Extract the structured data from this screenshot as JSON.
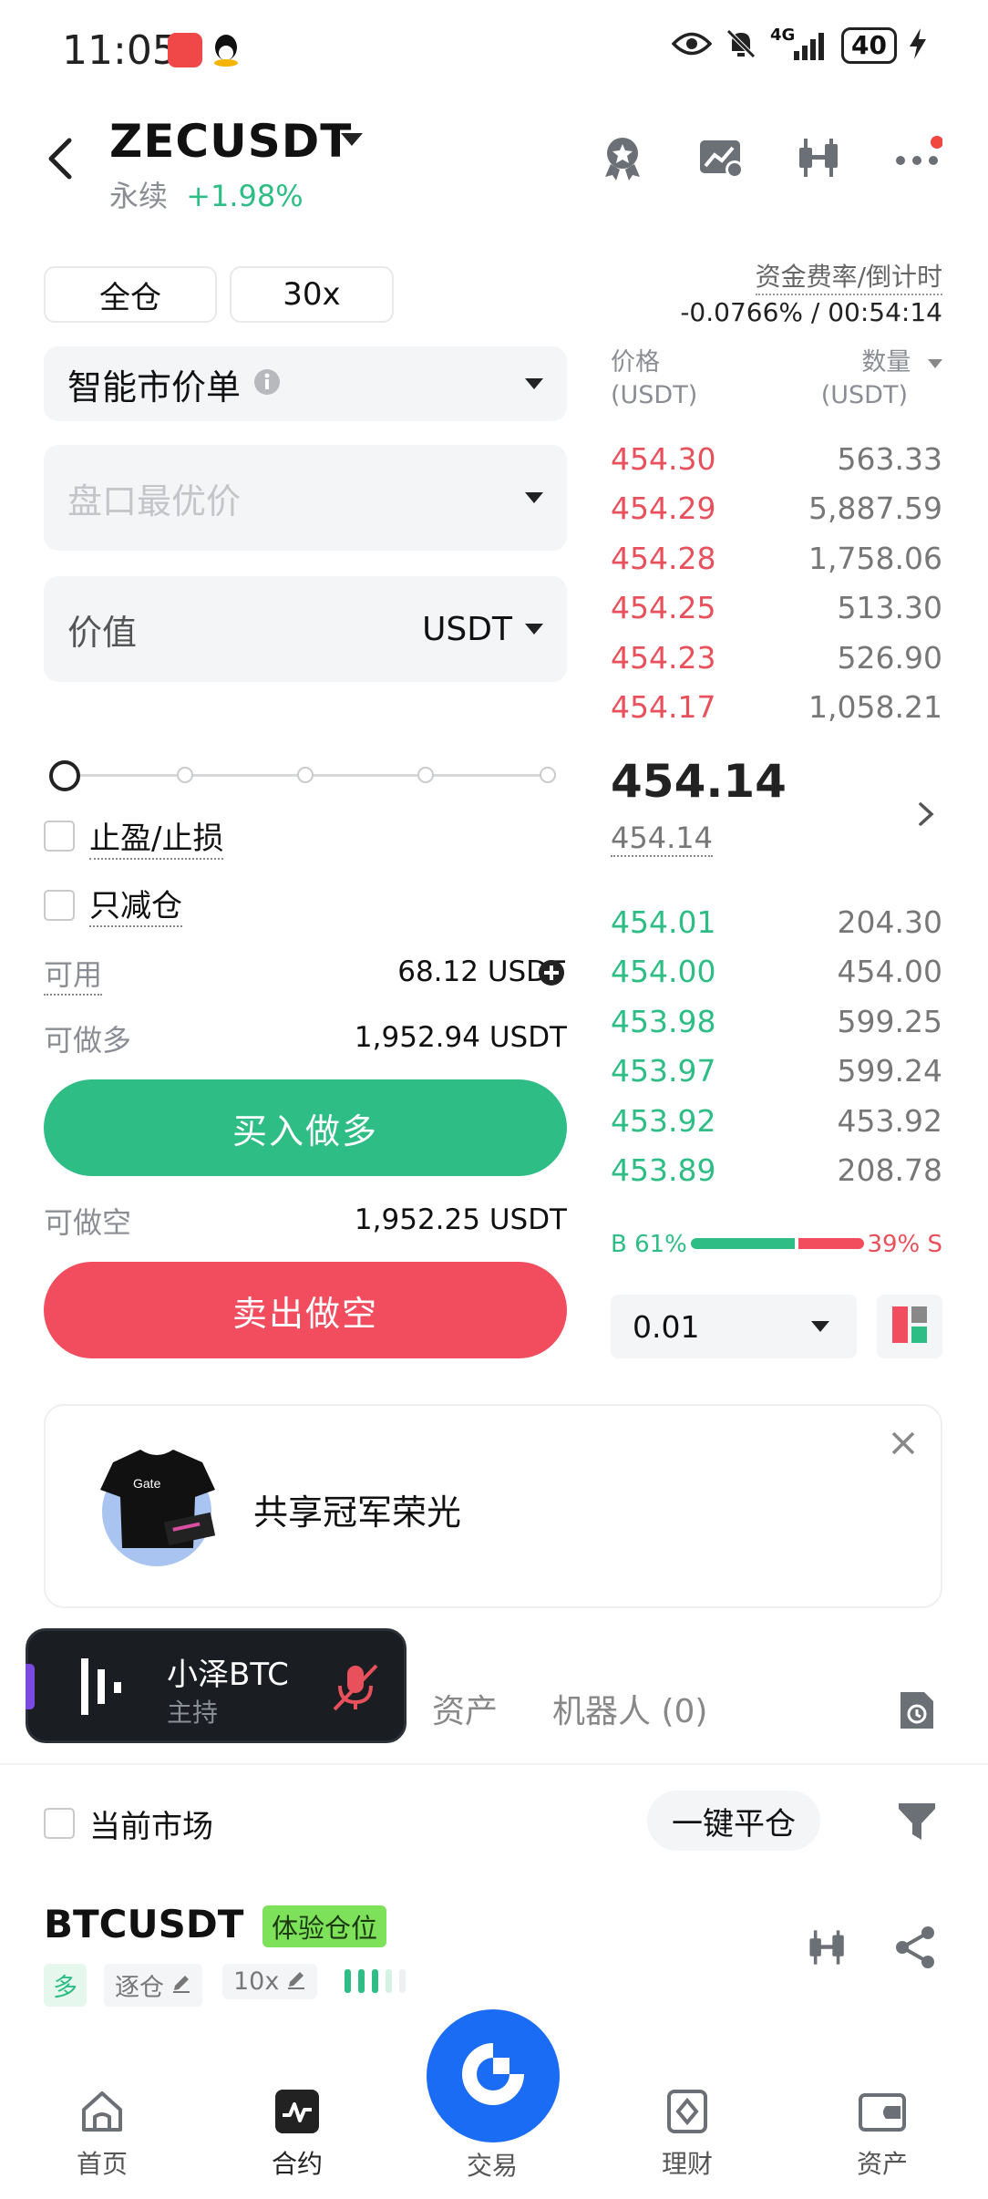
{
  "status": {
    "time": "11:05",
    "network": "4G",
    "battery": "40"
  },
  "header": {
    "pair": "ZECUSDT",
    "type": "永续",
    "change": "+1.98%"
  },
  "margin": {
    "mode": "全仓",
    "leverage": "30x"
  },
  "funding": {
    "label": "资金费率/倒计时",
    "value": "-0.0766% / 00:54:14"
  },
  "form": {
    "order_type": "智能市价单",
    "price_placeholder": "盘口最优价",
    "value_label": "价值",
    "value_unit": "USDT",
    "tp_sl": "止盈/止损",
    "reduce_only": "只减仓",
    "available_label": "可用",
    "available_value": "68.12  USDT",
    "long_label": "可做多",
    "long_value": "1,952.94 USDT",
    "buy_button": "买入做多",
    "short_label": "可做空",
    "short_value": "1,952.25 USDT",
    "sell_button": "卖出做空"
  },
  "orderbook": {
    "price_header": "价格",
    "price_unit": "(USDT)",
    "qty_header": "数量",
    "qty_unit": "(USDT)",
    "asks": [
      {
        "price": "454.30",
        "qty": "563.33"
      },
      {
        "price": "454.29",
        "qty": "5,887.59"
      },
      {
        "price": "454.28",
        "qty": "1,758.06"
      },
      {
        "price": "454.25",
        "qty": "513.30"
      },
      {
        "price": "454.23",
        "qty": "526.90"
      },
      {
        "price": "454.17",
        "qty": "1,058.21"
      }
    ],
    "last_price": "454.14",
    "mark_price": "454.14",
    "bids": [
      {
        "price": "454.01",
        "qty": "204.30"
      },
      {
        "price": "454.00",
        "qty": "454.00"
      },
      {
        "price": "453.98",
        "qty": "599.25"
      },
      {
        "price": "453.97",
        "qty": "599.24"
      },
      {
        "price": "453.92",
        "qty": "453.92"
      },
      {
        "price": "453.89",
        "qty": "208.78"
      }
    ],
    "buy_ratio": "B 61%",
    "sell_ratio": "39% S",
    "buy_fraction": 0.61,
    "precision": "0.01"
  },
  "promo": {
    "text": "共享冠军荣光",
    "shirt_logo": "Gate"
  },
  "live": {
    "host": "小泽BTC",
    "role": "主持"
  },
  "tabs": {
    "assets": "资产",
    "bots": "机器人 (0)"
  },
  "positions": {
    "current_market": "当前市场",
    "close_all": "一键平仓",
    "symbol": "BTCUSDT",
    "badge": "体验仓位",
    "side": "多",
    "margin_mode": "逐仓",
    "leverage": "10x"
  },
  "nav": {
    "home": "首页",
    "futures": "合约",
    "trade": "交易",
    "finance": "理财",
    "assets": "资产"
  },
  "colors": {
    "green": "#2ebd85",
    "red": "#f24d5e",
    "brand": "#1a6cf5"
  }
}
